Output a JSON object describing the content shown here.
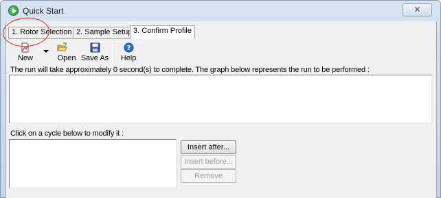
{
  "window": {
    "title": "Quick Start",
    "close_glyph": "✕"
  },
  "tabs": [
    {
      "label": "1. Rotor Selection",
      "active": false
    },
    {
      "label": "2. Sample Setup",
      "active": false
    },
    {
      "label": "3. Confirm Profile",
      "active": true
    }
  ],
  "toolbar": {
    "new_label": "New",
    "open_label": "Open",
    "save_as_label": "Save As",
    "help_label": "Help"
  },
  "info_text": "The run will take approximately 0 second(s) to complete. The graph below represents the run to be performed :",
  "cycle_label": "Click on a cycle below to modify it :",
  "buttons": {
    "insert_after": "Insert after...",
    "insert_before": "Insert before...",
    "remove": "Remove"
  },
  "colors": {
    "annotation_circle": "#e02020",
    "title_icon": "#1f8f2f"
  },
  "icons": [
    "quick-start-icon",
    "new-document-icon",
    "open-folder-icon",
    "save-disk-icon",
    "help-icon"
  ]
}
